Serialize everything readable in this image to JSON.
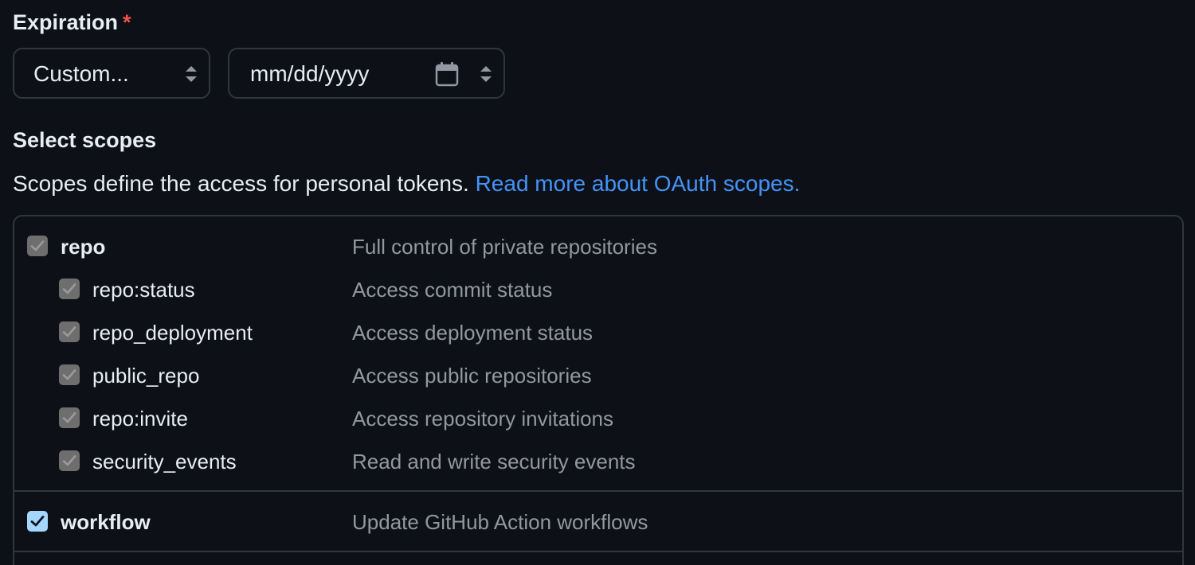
{
  "expiration": {
    "label": "Expiration",
    "required_marker": "*",
    "preset_select": {
      "value": "Custom..."
    },
    "date_input": {
      "placeholder": "mm/dd/yyyy"
    }
  },
  "scopes": {
    "heading": "Select scopes",
    "description": "Scopes define the access for personal tokens.",
    "link_text": "Read more about OAuth scopes.",
    "groups": [
      {
        "name": "repo",
        "description": "Full control of private repositories",
        "checked": true,
        "disabled": true,
        "children": [
          {
            "name": "repo:status",
            "description": "Access commit status",
            "checked": true
          },
          {
            "name": "repo_deployment",
            "description": "Access deployment status",
            "checked": true
          },
          {
            "name": "public_repo",
            "description": "Access public repositories",
            "checked": true
          },
          {
            "name": "repo:invite",
            "description": "Access repository invitations",
            "checked": true
          },
          {
            "name": "security_events",
            "description": "Read and write security events",
            "checked": true
          }
        ]
      },
      {
        "name": "workflow",
        "description": "Update GitHub Action workflows",
        "checked": true,
        "disabled": false,
        "children": []
      }
    ]
  },
  "colors": {
    "background": "#0d1117",
    "border": "#30363d",
    "link": "#4493f8",
    "required": "#f85149",
    "checkbox_active": "#a5d6ff",
    "checkbox_disabled": "#6e6e6e",
    "muted_text": "#9198a1"
  },
  "icons": {
    "calendar": "calendar-icon",
    "select_arrows": "updown-arrows-icon",
    "checkmark": "check-icon"
  }
}
